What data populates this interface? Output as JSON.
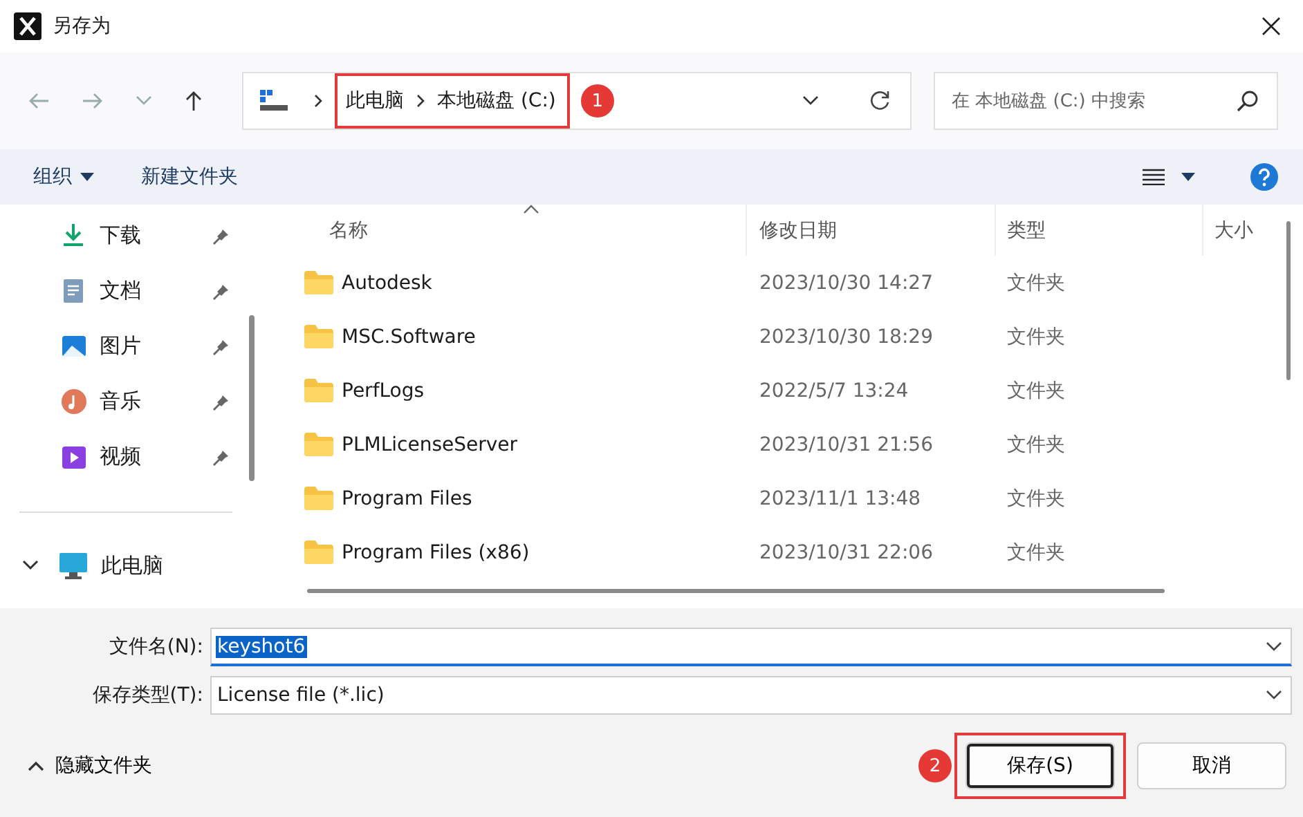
{
  "window": {
    "title": "另存为"
  },
  "nav": {
    "breadcrumb": [
      "此电脑",
      "本地磁盘 (C:)"
    ],
    "search": {
      "placeholder": "在 本地磁盘 (C:) 中搜索"
    }
  },
  "toolbar": {
    "organize": "组织",
    "new_folder": "新建文件夹"
  },
  "sidebar": {
    "quick_access": [
      {
        "label": "下载",
        "kind": "download",
        "pinned": true
      },
      {
        "label": "文档",
        "kind": "document",
        "pinned": true
      },
      {
        "label": "图片",
        "kind": "picture",
        "pinned": true
      },
      {
        "label": "音乐",
        "kind": "music",
        "pinned": true
      },
      {
        "label": "视频",
        "kind": "video",
        "pinned": true
      }
    ],
    "this_pc": {
      "label": "此电脑",
      "expanded": true
    }
  },
  "table": {
    "columns": [
      {
        "label": "名称",
        "sorted": true
      },
      {
        "label": "修改日期",
        "sorted": false
      },
      {
        "label": "类型",
        "sorted": false
      },
      {
        "label": "大小",
        "sorted": false
      }
    ],
    "rows": [
      {
        "name": "Autodesk",
        "modified": "2023/10/30 14:27",
        "type": "文件夹"
      },
      {
        "name": "MSC.Software",
        "modified": "2023/10/30 18:29",
        "type": "文件夹"
      },
      {
        "name": "PerfLogs",
        "modified": "2022/5/7 13:24",
        "type": "文件夹"
      },
      {
        "name": "PLMLicenseServer",
        "modified": "2023/10/31 21:56",
        "type": "文件夹"
      },
      {
        "name": "Program Files",
        "modified": "2023/11/1 13:48",
        "type": "文件夹"
      },
      {
        "name": "Program Files (x86)",
        "modified": "2023/10/31 22:06",
        "type": "文件夹"
      }
    ]
  },
  "form": {
    "file_name": {
      "label": "文件名(N):",
      "value": "keyshot6",
      "text_selected": true
    },
    "file_type": {
      "label": "保存类型(T):",
      "value": "License file (*.lic)"
    }
  },
  "footer": {
    "hide_folders": "隐藏文件夹",
    "buttons": [
      {
        "label": "保存(S)",
        "kind": "primary"
      },
      {
        "label": "取消",
        "kind": "secondary"
      }
    ]
  },
  "annotations": [
    {
      "label": "1"
    },
    {
      "label": "2"
    }
  ]
}
